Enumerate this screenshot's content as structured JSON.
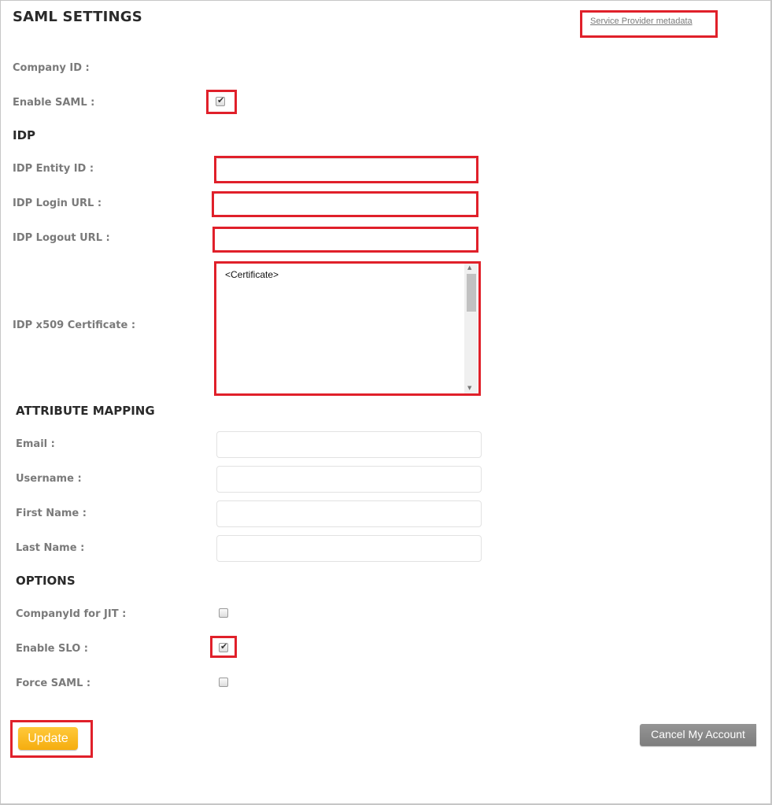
{
  "header": {
    "title": "SAML SETTINGS",
    "sp_metadata_link": "Service Provider metadata"
  },
  "general": {
    "company_id_label": "Company ID :",
    "company_id_value": "",
    "enable_saml_label": "Enable SAML :",
    "enable_saml_checked": true
  },
  "idp": {
    "heading": "IDP",
    "entity_id_label": "IDP Entity ID :",
    "entity_id_value": "",
    "login_url_label": "IDP Login URL :",
    "login_url_value": "",
    "logout_url_label": "IDP Logout URL :",
    "logout_url_value": "",
    "certificate_label": "IDP x509 Certificate :",
    "certificate_value": "<Certificate>"
  },
  "attribute_mapping": {
    "heading": "ATTRIBUTE MAPPING",
    "fields": [
      {
        "label": "Email :",
        "value": ""
      },
      {
        "label": "Username :",
        "value": ""
      },
      {
        "label": "First Name :",
        "value": ""
      },
      {
        "label": "Last Name :",
        "value": ""
      }
    ]
  },
  "options": {
    "heading": "OPTIONS",
    "items": [
      {
        "label": "CompanyId for JIT :",
        "checked": false
      },
      {
        "label": "Enable SLO :",
        "checked": true
      },
      {
        "label": "Force SAML :",
        "checked": false
      }
    ]
  },
  "actions": {
    "update_label": "Update",
    "cancel_account_label": "Cancel My Account"
  },
  "icons": {
    "check": "✔",
    "scroll_up": "▲",
    "scroll_down": "▼"
  },
  "colors": {
    "highlight": "#e0202a",
    "update_button": "#f7b51a",
    "cancel_button": "#888888"
  }
}
